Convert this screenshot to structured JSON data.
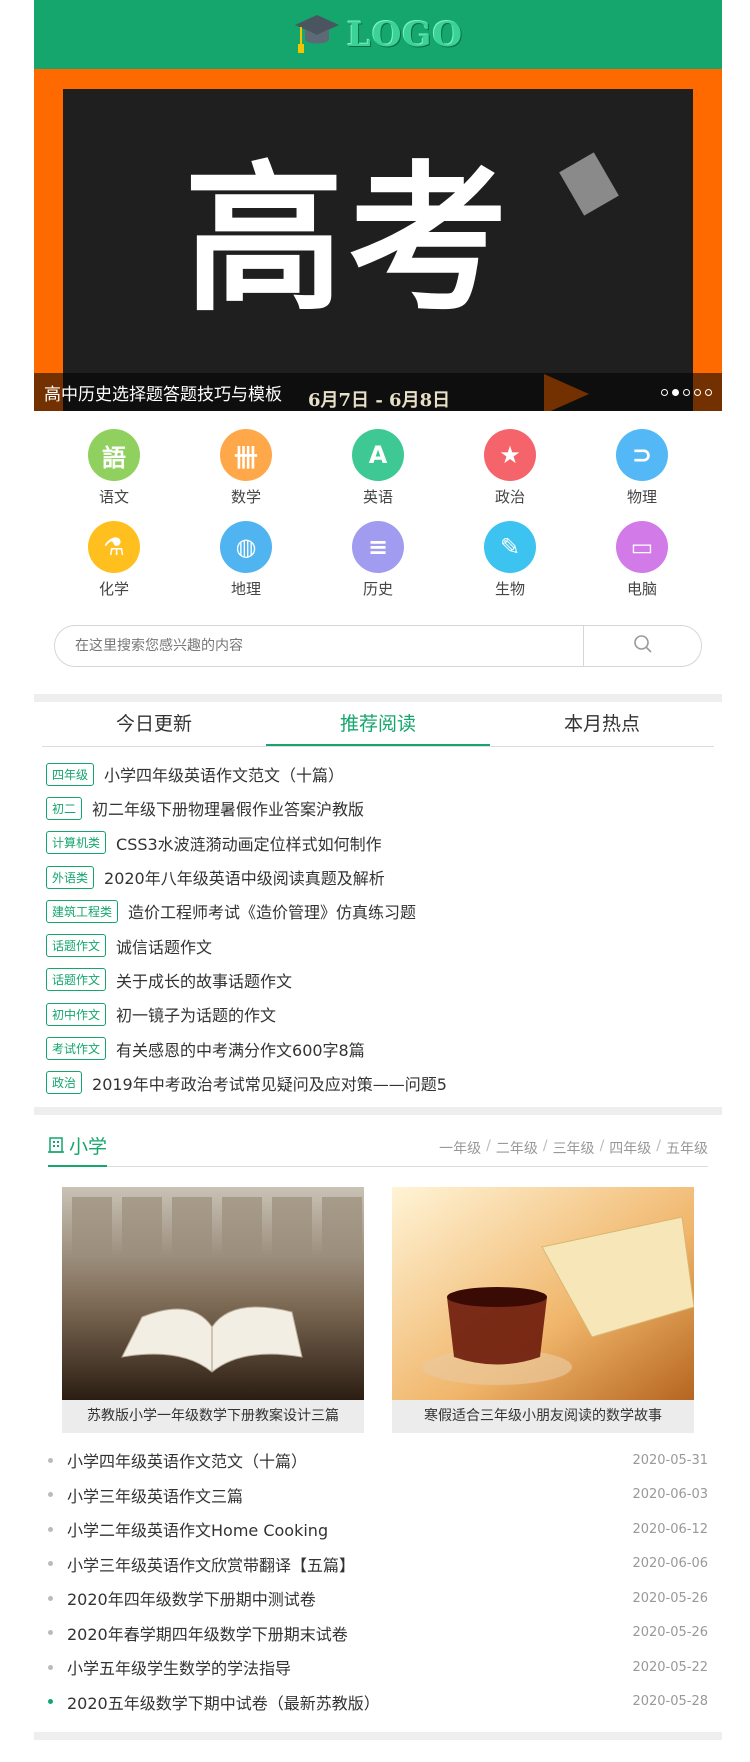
{
  "header": {
    "logo_text": "LOGO",
    "logo_icon": "graduation-cap-icon"
  },
  "banner": {
    "big_text": "高考",
    "date_text": "6月7日 - 6月8日",
    "caption": "高中历史选择题答题技巧与模板",
    "dot_count": 5,
    "active_dot": 2
  },
  "categories": [
    {
      "label": "语文",
      "icon": "book-icon",
      "color": "#8fd05e",
      "glyph": "語"
    },
    {
      "label": "数学",
      "icon": "abacus-icon",
      "color": "#ffa84a",
      "glyph": "卌"
    },
    {
      "label": "英语",
      "icon": "letter-a-icon",
      "color": "#3ec994",
      "glyph": "A"
    },
    {
      "label": "政治",
      "icon": "star-badge-icon",
      "color": "#f5646a",
      "glyph": "★"
    },
    {
      "label": "物理",
      "icon": "magnet-icon",
      "color": "#53b8f5",
      "glyph": "⊃"
    },
    {
      "label": "化学",
      "icon": "flask-icon",
      "color": "#ffbf1f",
      "glyph": "⚗"
    },
    {
      "label": "地理",
      "icon": "globe-icon",
      "color": "#4fb4ef",
      "glyph": "◍"
    },
    {
      "label": "历史",
      "icon": "scroll-icon",
      "color": "#a29cf0",
      "glyph": "≡"
    },
    {
      "label": "生物",
      "icon": "microscope-icon",
      "color": "#3dc3ef",
      "glyph": "✎"
    },
    {
      "label": "电脑",
      "icon": "computer-icon",
      "color": "#d17ae8",
      "glyph": "▭"
    }
  ],
  "search": {
    "placeholder": "在这里搜索您感兴趣的内容",
    "icon": "search-icon"
  },
  "tabs": [
    "今日更新",
    "推荐阅读",
    "本月热点"
  ],
  "active_tab": 1,
  "news": [
    {
      "tag": "四年级",
      "title": "小学四年级英语作文范文（十篇）"
    },
    {
      "tag": "初二",
      "title": "初二年级下册物理暑假作业答案沪教版"
    },
    {
      "tag": "计算机类",
      "title": "CSS3水波涟漪动画定位样式如何制作"
    },
    {
      "tag": "外语类",
      "title": "2020年八年级英语中级阅读真题及解析"
    },
    {
      "tag": "建筑工程类",
      "title": "造价工程师考试《造价管理》仿真练习题"
    },
    {
      "tag": "话题作文",
      "title": "诚信话题作文"
    },
    {
      "tag": "话题作文",
      "title": "关于成长的故事话题作文"
    },
    {
      "tag": "初中作文",
      "title": "初一镜子为话题的作文"
    },
    {
      "tag": "考试作文",
      "title": "有关感恩的中考满分作文600字8篇"
    },
    {
      "tag": "政治",
      "title": "2019年中考政治考试常见疑问及应对策——问题5"
    }
  ],
  "section": {
    "title": "小学",
    "grades": [
      "一年级",
      "二年级",
      "三年级",
      "四年级",
      "五年级"
    ],
    "separator": "/",
    "pictures": [
      {
        "caption": "苏教版小学一年级数学下册教案设计三篇"
      },
      {
        "caption": "寒假适合三年级小朋友阅读的数学故事"
      }
    ],
    "items": [
      {
        "title": "小学四年级英语作文范文（十篇）",
        "date": "2020-05-31"
      },
      {
        "title": "小学三年级英语作文三篇",
        "date": "2020-06-03"
      },
      {
        "title": "小学二年级英语作文Home Cooking",
        "date": "2020-06-12"
      },
      {
        "title": "小学三年级英语作文欣赏带翻译【五篇】",
        "date": "2020-06-06"
      },
      {
        "title": "2020年四年级数学下册期中测试卷",
        "date": "2020-05-26"
      },
      {
        "title": "2020年春学期四年级数学下册期末试卷",
        "date": "2020-05-26"
      },
      {
        "title": "小学五年级学生数学的学法指导",
        "date": "2020-05-22"
      },
      {
        "title": "2020五年级数学下期中试卷（最新苏教版）",
        "date": "2020-05-28"
      }
    ],
    "active_item": 7
  },
  "colors": {
    "brand": "#14a66d",
    "banner_orange": "#ff6a00"
  }
}
